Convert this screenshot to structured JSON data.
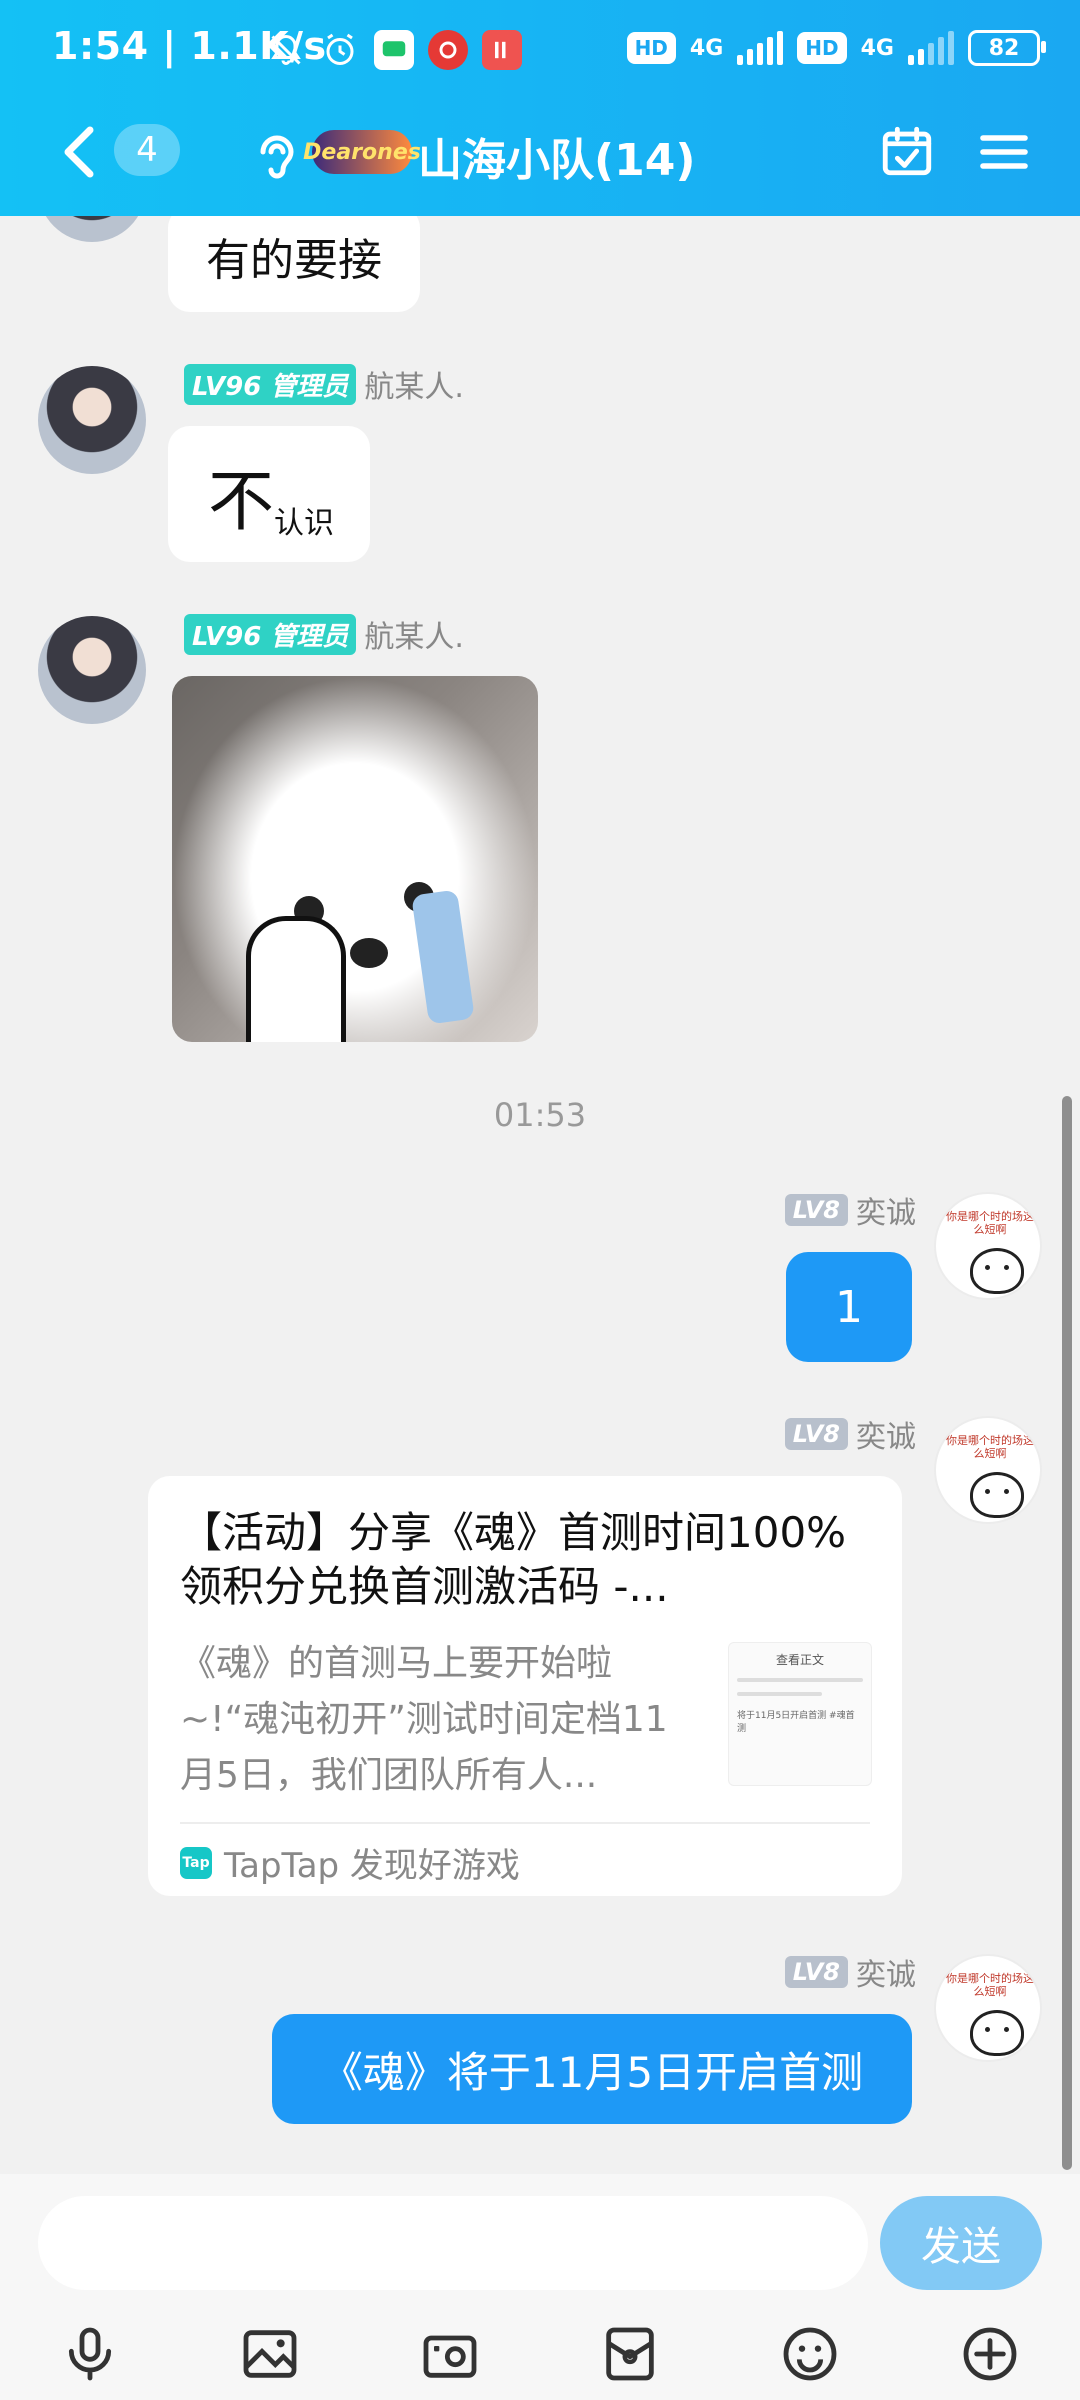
{
  "status_bar": {
    "time": "1:54",
    "speed": "1.1K/s",
    "hd1": "HD",
    "net1": "4G",
    "hd2": "HD",
    "net2": "4G",
    "battery": "82",
    "icons": [
      "bell-off-icon",
      "alarm-icon",
      "message-app-icon",
      "netease-music-icon",
      "listen-app-icon"
    ]
  },
  "header": {
    "unread_count": "4",
    "badge_logo": "Dearones",
    "title": "山海小队(14)"
  },
  "messages": [
    {
      "text": "有的要接"
    },
    {
      "level": "LV96",
      "role": "管理员",
      "sender": "航某人.",
      "big_char": "不",
      "small_text": "认识"
    },
    {
      "level": "LV96",
      "role": "管理员",
      "sender": "航某人."
    },
    {
      "timestamp": "01:53"
    },
    {
      "level": "LV8",
      "sender": "奕诚",
      "text": "1"
    },
    {
      "level": "LV8",
      "sender": "奕诚",
      "card": {
        "title": "【活动】分享《魂》首测时间100%领积分兑换首测激活码 -...",
        "description": "《魂》的首测马上要开始啦~!“魂沌初开”测试时间定档11月5日，我们团队所有人...",
        "source": "TapTap 发现好游戏",
        "source_logo": "Tap",
        "thumb_title": "查看正文",
        "thumb_line": "将于11月5日开启首测 #魂首测"
      }
    },
    {
      "level": "LV8",
      "sender": "奕诚",
      "text": "《魂》将于11月5日开启首测"
    }
  ],
  "avatar_caption": "你是哪个时的场这么短啊",
  "input": {
    "placeholder": "",
    "send_label": "发送"
  },
  "toolbar": [
    "microphone-icon",
    "image-icon",
    "camera-icon",
    "red-packet-icon",
    "emoji-icon",
    "plus-icon"
  ],
  "colors": {
    "header": "#1aa8f2",
    "bubble_self": "#1e99f6",
    "admin_badge": "#2fd2c5",
    "send_button": "#82c9f5"
  }
}
